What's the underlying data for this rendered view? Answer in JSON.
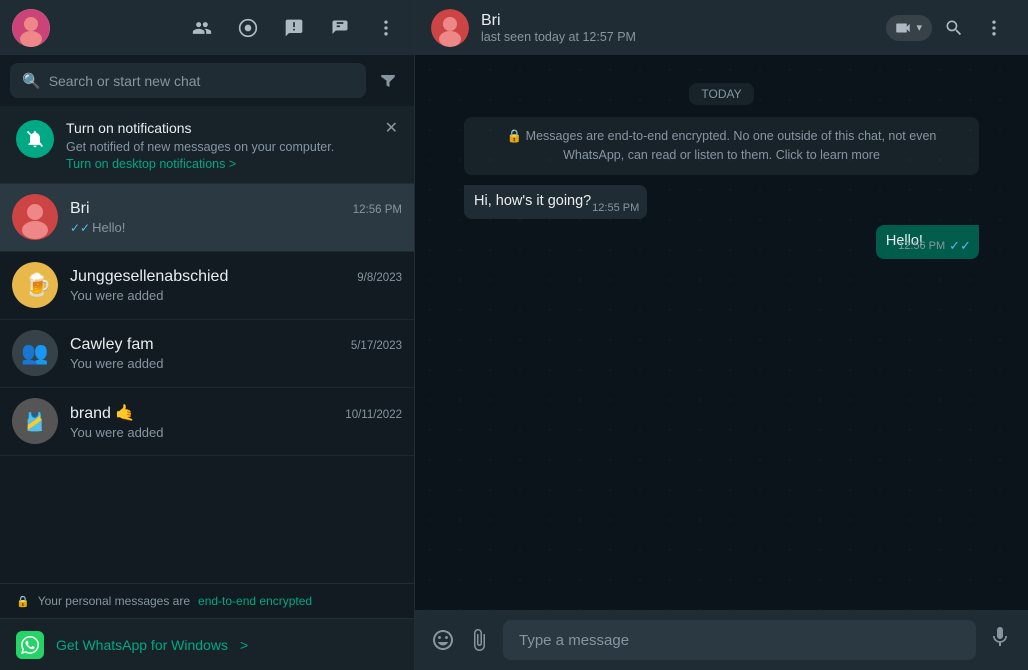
{
  "app": {
    "title": "WhatsApp"
  },
  "left_header": {
    "icons": [
      "new_group",
      "status",
      "channels",
      "new_chat",
      "menu"
    ]
  },
  "search": {
    "placeholder": "Search or start new chat"
  },
  "notification_banner": {
    "title": "Turn on notifications",
    "subtitle": "Get notified of new messages on your computer.",
    "link_text": "Turn on desktop notifications >"
  },
  "chats": [
    {
      "id": "bri",
      "name": "Bri",
      "time": "12:56 PM",
      "preview": "Hello!",
      "has_tick": true,
      "active": true,
      "avatar_color": "#c44"
    },
    {
      "id": "junggesellenabschied",
      "name": "Junggesellenabschied",
      "time": "9/8/2023",
      "preview": "You were added",
      "has_tick": false,
      "active": false,
      "avatar_color": "#e8b84b"
    },
    {
      "id": "cawley-fam",
      "name": "Cawley fam",
      "time": "5/17/2023",
      "preview": "You were added",
      "has_tick": false,
      "active": false,
      "avatar_color": "#374248"
    },
    {
      "id": "brand",
      "name": "brand 🤙",
      "time": "10/11/2022",
      "preview": "You were added",
      "has_tick": false,
      "active": false,
      "avatar_color": "#555"
    }
  ],
  "footer": {
    "lock_text": "🔒",
    "text": "Your personal messages are ",
    "link_text": "end-to-end encrypted"
  },
  "get_whatsapp": {
    "label": "Get WhatsApp for Windows",
    "arrow": ">"
  },
  "right_header": {
    "contact_name": "Bri",
    "status": "last seen today at 12:57 PM",
    "video_label": "",
    "icons": [
      "video",
      "search",
      "menu"
    ]
  },
  "chat": {
    "date_badge": "TODAY",
    "encryption_notice": "🔒 Messages are end-to-end encrypted. No one outside of this chat, not even WhatsApp, can read or listen to them. Click to learn more",
    "messages": [
      {
        "id": "msg1",
        "type": "incoming",
        "text": "Hi, how's it going?",
        "time": "12:55 PM",
        "tick": null
      },
      {
        "id": "msg2",
        "type": "outgoing",
        "text": "Hello!",
        "time": "12:56 PM",
        "tick": "✓✓"
      }
    ]
  },
  "input_bar": {
    "placeholder": "Type a message"
  }
}
